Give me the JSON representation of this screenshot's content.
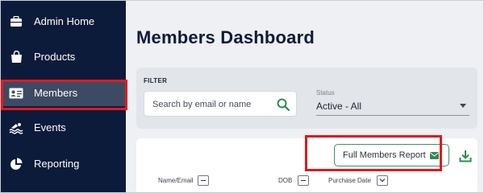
{
  "sidebar": {
    "items": [
      {
        "label": "Admin Home",
        "icon": "briefcase-icon"
      },
      {
        "label": "Products",
        "icon": "shopping-bag-icon"
      },
      {
        "label": "Members",
        "icon": "id-card-icon",
        "active": true
      },
      {
        "label": "Events",
        "icon": "swimmer-icon"
      },
      {
        "label": "Reporting",
        "icon": "pie-chart-icon"
      }
    ]
  },
  "main": {
    "title": "Members Dashboard",
    "filter": {
      "label": "FILTER",
      "search_placeholder": "Search by email or name",
      "status_label": "Status",
      "status_value": "Active - All"
    },
    "results": {
      "report_button_label": "Full Members Report",
      "columns": [
        {
          "label": "Name/Email",
          "control": "minus"
        },
        {
          "label": "DOB",
          "control": "minus"
        },
        {
          "label": "Purchase Date",
          "control": "chevron-down"
        }
      ]
    }
  },
  "colors": {
    "sidebar_bg": "#0d1b3a",
    "active_item_bg": "#3d4a63",
    "highlight_red": "#e0191e",
    "accent_green": "#2e8b57"
  }
}
